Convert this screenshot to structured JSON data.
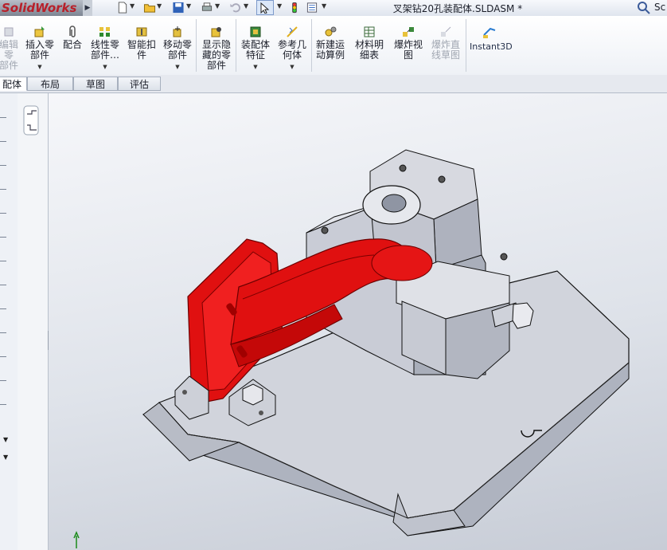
{
  "app": {
    "brand": "SolidWorks",
    "document_title": "叉架钻20孔装配体.SLDASM *",
    "search_text": "Sc"
  },
  "quick_access": [
    {
      "icon": "new-document-icon"
    },
    {
      "icon": "open-folder-icon"
    },
    {
      "icon": "save-icon"
    },
    {
      "icon": "print-icon"
    },
    {
      "icon": "undo-icon"
    },
    {
      "icon": "select-pointer-icon"
    },
    {
      "icon": "rebuild-traffic-light-icon"
    },
    {
      "icon": "options-list-icon"
    }
  ],
  "command_manager": {
    "items": [
      {
        "label_line1": "编辑零",
        "label_line2": "部件",
        "icon": "edit-component-icon",
        "enabled": false
      },
      {
        "label_line1": "插入零",
        "label_line2": "部件",
        "icon": "insert-component-icon",
        "enabled": true
      },
      {
        "label_line1": "配合",
        "label_line2": "",
        "icon": "mate-paperclip-icon",
        "enabled": true
      },
      {
        "label_line1": "线性零",
        "label_line2": "部件…",
        "icon": "linear-pattern-icon",
        "enabled": true
      },
      {
        "label_line1": "智能扣",
        "label_line2": "件",
        "icon": "smart-fasteners-icon",
        "enabled": true
      },
      {
        "label_line1": "移动零",
        "label_line2": "部件",
        "icon": "move-component-icon",
        "enabled": true
      },
      {
        "label_line1": "显示隐",
        "label_line2": "藏的零",
        "label_line3": "部件",
        "icon": "show-hidden-icon",
        "enabled": true
      },
      {
        "label_line1": "装配体",
        "label_line2": "特征",
        "icon": "assembly-features-icon",
        "enabled": true
      },
      {
        "label_line1": "参考几",
        "label_line2": "何体",
        "icon": "reference-geometry-icon",
        "enabled": true
      },
      {
        "label_line1": "新建运",
        "label_line2": "动算例",
        "icon": "new-motion-study-icon",
        "enabled": true
      },
      {
        "label_line1": "材料明",
        "label_line2": "细表",
        "icon": "bill-of-materials-icon",
        "enabled": true
      },
      {
        "label_line1": "爆炸视",
        "label_line2": "图",
        "icon": "exploded-view-icon",
        "enabled": true
      },
      {
        "label_line1": "爆炸直",
        "label_line2": "线草图",
        "icon": "explode-line-sketch-icon",
        "enabled": false
      },
      {
        "label_line1": "Instant3D",
        "label_line2": "",
        "icon": "instant3d-icon",
        "enabled": true
      }
    ]
  },
  "tabs": [
    {
      "label": "配体",
      "active": true
    },
    {
      "label": "布局",
      "active": false
    },
    {
      "label": "草图",
      "active": false
    },
    {
      "label": "评估",
      "active": false
    }
  ],
  "view_toolbar": [
    {
      "icon": "zoom-to-fit-icon"
    },
    {
      "icon": "zoom-to-area-icon"
    },
    {
      "icon": "previous-view-icon"
    },
    {
      "icon": "section-view-icon"
    },
    {
      "icon": "view-orientation-icon"
    },
    {
      "icon": "display-style-icon"
    },
    {
      "icon": "hide-show-items-icon"
    },
    {
      "icon": "edit-appearance-icon"
    },
    {
      "icon": "apply-scene-icon"
    },
    {
      "icon": "view-settings-icon"
    }
  ],
  "colors": {
    "part_red": "#e01010",
    "steel_gray": "#c9ccd6",
    "brand_red": "#b8202a"
  }
}
